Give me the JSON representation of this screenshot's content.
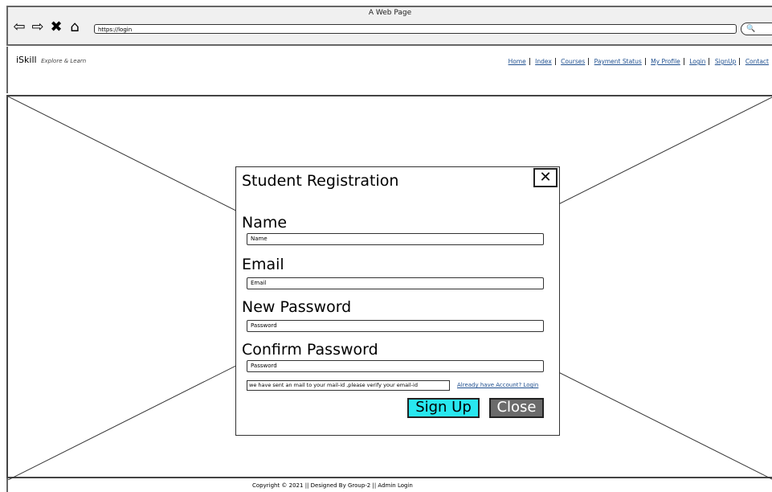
{
  "browser": {
    "title": "A Web Page",
    "url": "https://login",
    "back_icon": "back-arrow-icon",
    "forward_icon": "forward-arrow-icon",
    "stop_icon": "close-icon",
    "home_icon": "home-icon"
  },
  "header": {
    "brand": "iSkill",
    "tagline": "Explore & Learn",
    "nav": [
      "Home",
      "Index",
      "Courses",
      "Payment Status",
      "My Profile",
      "Login",
      "SignUp",
      "Contact"
    ]
  },
  "modal": {
    "title": "Student Registration",
    "close_icon": "close-x-icon",
    "fields": [
      {
        "label": "Name",
        "placeholder": "Name"
      },
      {
        "label": "Email",
        "placeholder": "Email"
      },
      {
        "label": "New Password",
        "placeholder": "Password"
      },
      {
        "label": "Confirm Password",
        "placeholder": "Password"
      }
    ],
    "notice": "we have sent an mail to your mail-id ,please verify your email-id",
    "login_link": "Already have Account? Login",
    "signup_label": "Sign Up",
    "close_label": "Close",
    "signup_color": "#29e7ef",
    "close_color": "#6b6b6b"
  },
  "footer": {
    "text": "Copyright © 2021 || Designed By Group-2 || Admin Login"
  }
}
